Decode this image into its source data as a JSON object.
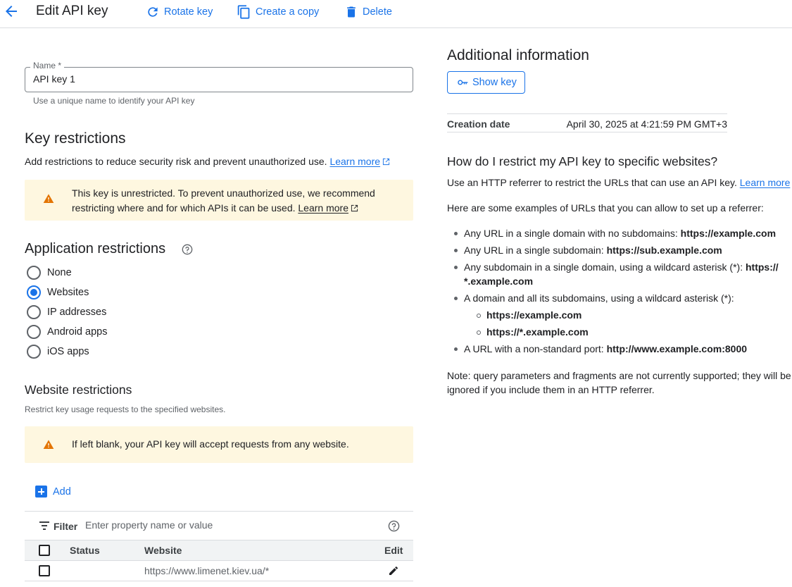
{
  "header": {
    "title": "Edit API key",
    "rotate_label": "Rotate key",
    "copy_label": "Create a copy",
    "delete_label": "Delete"
  },
  "name_field": {
    "label": "Name *",
    "value": "API key 1",
    "hint": "Use a unique name to identify your API key"
  },
  "key_restrictions": {
    "title": "Key restrictions",
    "description": "Add restrictions to reduce security risk and prevent unauthorized use.",
    "learn_more": "Learn more",
    "warning_line1": "This key is unrestricted. To prevent unauthorized use, we recommend",
    "warning_line2": "restricting where and for which APIs it can be used.",
    "warning_learn_more": "Learn more"
  },
  "app_restrictions": {
    "title": "Application restrictions",
    "options": [
      {
        "label": "None",
        "checked": false
      },
      {
        "label": "Websites",
        "checked": true
      },
      {
        "label": "IP addresses",
        "checked": false
      },
      {
        "label": "Android apps",
        "checked": false
      },
      {
        "label": "iOS apps",
        "checked": false
      }
    ]
  },
  "website_restrictions": {
    "title": "Website restrictions",
    "description": "Restrict key usage requests to the specified websites.",
    "warning": "If left blank, your API key will accept requests from any website.",
    "add_label": "Add",
    "filter_label": "Filter",
    "filter_placeholder": "Enter property name or value",
    "columns": {
      "status": "Status",
      "website": "Website",
      "edit": "Edit"
    },
    "rows": [
      {
        "status": "",
        "website": "https://www.limenet.kiev.ua/*"
      }
    ]
  },
  "additional_info": {
    "title": "Additional information",
    "show_key_label": "Show key",
    "creation_date_label": "Creation date",
    "creation_date_value": "April 30, 2025 at 4:21:59 PM GMT+3"
  },
  "help": {
    "title": "How do I restrict my API key to specific websites?",
    "intro": "Use an HTTP referrer to restrict the URLs that can use an API key.",
    "learn_more": "Learn more",
    "examples_intro": "Here are some examples of URLs that you can allow to set up a referrer:",
    "b1_text": "Any URL in a single domain with no subdomains: ",
    "b1_url": "https://example.com",
    "b2_text": "Any URL in a single subdomain: ",
    "b2_url": "https://sub.example.com",
    "b3_text": "Any subdomain in a single domain, using a wildcard asterisk (*): ",
    "b3_url1": "https://",
    "b3_url2": "*.example.com",
    "b4_text": "A domain and all its subdomains, using a wildcard asterisk (*):",
    "b4_sub1": "https://example.com",
    "b4_sub2": "https://*.example.com",
    "b5_text": "A URL with a non-standard port: ",
    "b5_url": "http://www.example.com:8000",
    "note_line1": "Note: query parameters and fragments are not currently supported; they will be",
    "note_line2": "ignored if you include them in an HTTP referrer."
  }
}
